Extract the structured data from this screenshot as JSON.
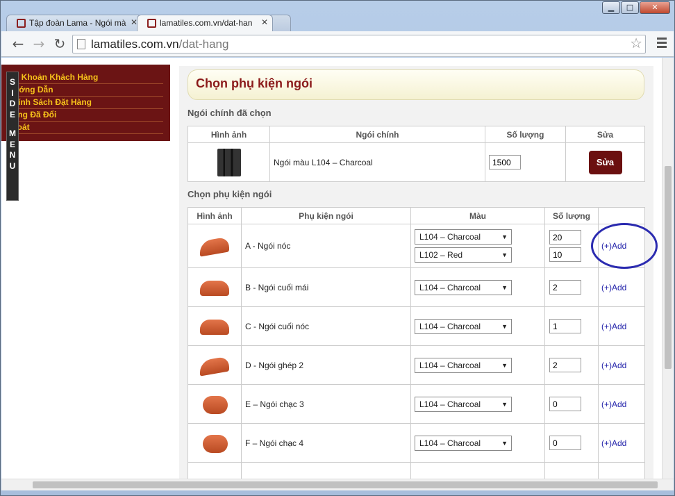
{
  "browser": {
    "tabs": [
      {
        "title": "Tập đoàn Lama - Ngói mà",
        "active": false
      },
      {
        "title": "lamatiles.com.vn/dat-han",
        "active": true
      }
    ],
    "url_host": "lamatiles.com.vn",
    "url_path": "/dat-hang",
    "window_controls": {
      "minimize": "▁",
      "maximize": "□",
      "close": "✕"
    }
  },
  "sidebar": {
    "items": [
      "Tài Khoản Khách Hàng",
      "Hướng Dẫn",
      "Chính Sách Đặt Hàng",
      "Hàng Đã Đổi",
      "Thoát"
    ],
    "side_menu_label": [
      "S",
      "I",
      "D",
      "E",
      " ",
      "M",
      "E",
      "N",
      "U"
    ]
  },
  "page": {
    "title": "Chọn phụ kiện ngói",
    "main_section_label": "Ngói chính đã chọn",
    "main_table": {
      "headers": [
        "Hình ảnh",
        "Ngói chính",
        "Số lượng",
        "Sửa"
      ],
      "row": {
        "name": "Ngói màu L104 – Charcoal",
        "quantity": "1500",
        "edit_label": "Sửa"
      }
    },
    "accessory_section_label": "Chọn phụ kiện ngói",
    "accessory_table": {
      "headers": [
        "Hình ảnh",
        "Phụ kiện ngói",
        "Màu",
        "Số lượng",
        ""
      ],
      "add_label": "(+)Add",
      "rows": [
        {
          "name": "A - Ngói nóc",
          "colors": [
            "L104 – Charcoal",
            "L102 – Red"
          ],
          "quantities": [
            "20",
            "10"
          ]
        },
        {
          "name": "B - Ngói cuối mái",
          "colors": [
            "L104 – Charcoal"
          ],
          "quantities": [
            "2"
          ]
        },
        {
          "name": "C - Ngói cuối nóc",
          "colors": [
            "L104 – Charcoal"
          ],
          "quantities": [
            "1"
          ]
        },
        {
          "name": "D - Ngói ghép 2",
          "colors": [
            "L104 – Charcoal"
          ],
          "quantities": [
            "2"
          ]
        },
        {
          "name": "E – Ngói chạc 3",
          "colors": [
            "L104 – Charcoal"
          ],
          "quantities": [
            "0"
          ]
        },
        {
          "name": "F – Ngói chạc 4",
          "colors": [
            "L104 – Charcoal"
          ],
          "quantities": [
            "0"
          ]
        }
      ]
    }
  },
  "colors": {
    "accent": "#6b1414",
    "heading_text": "#8b1a1a",
    "link": "#2222aa",
    "annotation_circle": "#2b2bb0"
  }
}
